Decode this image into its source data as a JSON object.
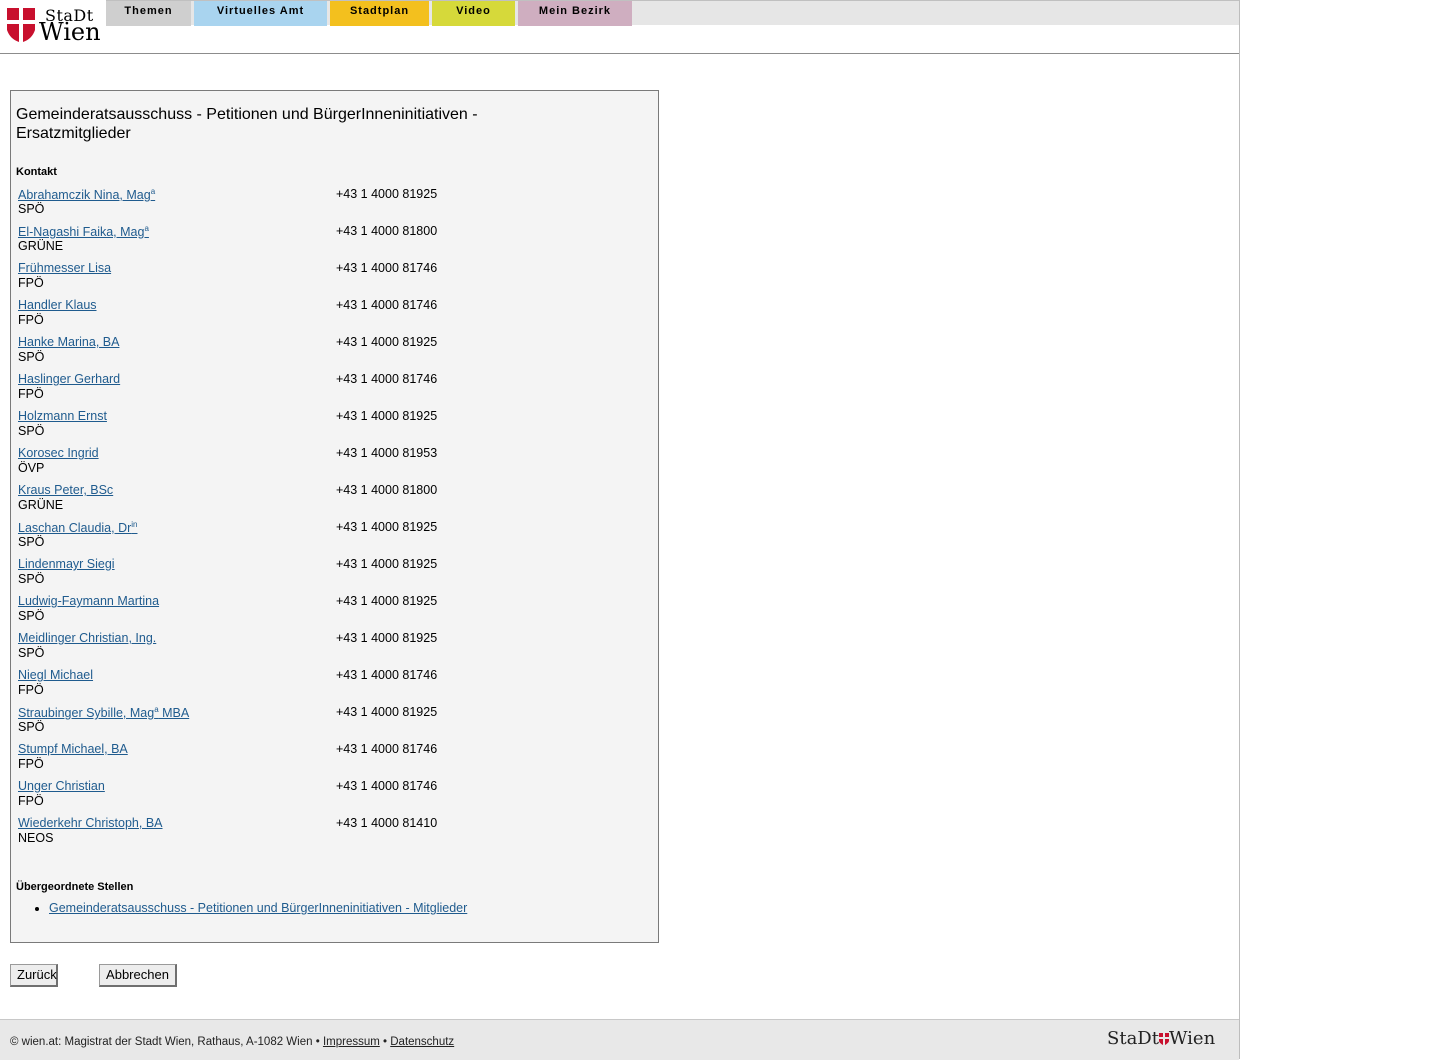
{
  "header": {
    "logo": {
      "stadt": "StaDt",
      "wien": "Wien"
    },
    "tabs": [
      {
        "key": "themen",
        "label": "Themen"
      },
      {
        "key": "amt",
        "label": "Virtuelles Amt"
      },
      {
        "key": "plan",
        "label": "Stadtplan"
      },
      {
        "key": "video",
        "label": "Video"
      },
      {
        "key": "bezirk",
        "label": "Mein Bezirk"
      }
    ]
  },
  "panel": {
    "title": "Gemeinderatsausschuss - Petitionen und BürgerInneninitiativen - Ersatzmitglieder",
    "contact_label": "Kontakt",
    "contacts": [
      {
        "name": "Abrahamczik Nina, Mag",
        "sup": "a",
        "suffix": "",
        "party": "SPÖ",
        "phone": "+43 1 4000 81925"
      },
      {
        "name": "El-Nagashi Faika, Mag",
        "sup": "a",
        "suffix": "",
        "party": "GRÜNE",
        "phone": "+43 1 4000 81800"
      },
      {
        "name": "Frühmesser Lisa",
        "sup": "",
        "suffix": "",
        "party": "FPÖ",
        "phone": "+43 1 4000 81746"
      },
      {
        "name": "Handler Klaus",
        "sup": "",
        "suffix": "",
        "party": "FPÖ",
        "phone": "+43 1 4000 81746"
      },
      {
        "name": "Hanke Marina, BA",
        "sup": "",
        "suffix": "",
        "party": "SPÖ",
        "phone": "+43 1 4000 81925"
      },
      {
        "name": "Haslinger Gerhard",
        "sup": "",
        "suffix": "",
        "party": "FPÖ",
        "phone": "+43 1 4000 81746"
      },
      {
        "name": "Holzmann Ernst",
        "sup": "",
        "suffix": "",
        "party": "SPÖ",
        "phone": "+43 1 4000 81925"
      },
      {
        "name": "Korosec Ingrid",
        "sup": "",
        "suffix": "",
        "party": "ÖVP",
        "phone": "+43 1 4000 81953"
      },
      {
        "name": "Kraus Peter, BSc",
        "sup": "",
        "suffix": "",
        "party": "GRÜNE",
        "phone": "+43 1 4000 81800"
      },
      {
        "name": "Laschan Claudia, Dr",
        "sup": "in",
        "suffix": "",
        "party": "SPÖ",
        "phone": "+43 1 4000 81925"
      },
      {
        "name": "Lindenmayr Siegi",
        "sup": "",
        "suffix": "",
        "party": "SPÖ",
        "phone": "+43 1 4000 81925"
      },
      {
        "name": "Ludwig-Faymann Martina",
        "sup": "",
        "suffix": "",
        "party": "SPÖ",
        "phone": "+43 1 4000 81925"
      },
      {
        "name": "Meidlinger Christian, Ing.",
        "sup": "",
        "suffix": "",
        "party": "SPÖ",
        "phone": "+43 1 4000 81925"
      },
      {
        "name": "Niegl Michael",
        "sup": "",
        "suffix": "",
        "party": "FPÖ",
        "phone": "+43 1 4000 81746"
      },
      {
        "name": "Straubinger Sybille, Mag",
        "sup": "a",
        "suffix": " MBA",
        "party": "SPÖ",
        "phone": "+43 1 4000 81925"
      },
      {
        "name": "Stumpf Michael, BA",
        "sup": "",
        "suffix": "",
        "party": "FPÖ",
        "phone": "+43 1 4000 81746"
      },
      {
        "name": "Unger Christian",
        "sup": "",
        "suffix": "",
        "party": "FPÖ",
        "phone": "+43 1 4000 81746"
      },
      {
        "name": "Wiederkehr Christoph, BA",
        "sup": "",
        "suffix": "",
        "party": "NEOS",
        "phone": "+43 1 4000 81410"
      }
    ],
    "parents_label": "Übergeordnete Stellen",
    "parents": [
      "Gemeinderatsausschuss - Petitionen und BürgerInneninitiativen - Mitglieder"
    ]
  },
  "buttons": {
    "back": "Zurück",
    "cancel": "Abbrechen"
  },
  "footer": {
    "text": "© wien.at: Magistrat der Stadt Wien, Rathaus, A-1082 Wien •",
    "impressum": "Impressum",
    "sep": "•",
    "datenschutz": "Datenschutz",
    "logo_stadt": "StaDt",
    "logo_wien": "Wien"
  },
  "colors": {
    "link": "#1f5b8e",
    "shield_red": "#c8102e"
  }
}
